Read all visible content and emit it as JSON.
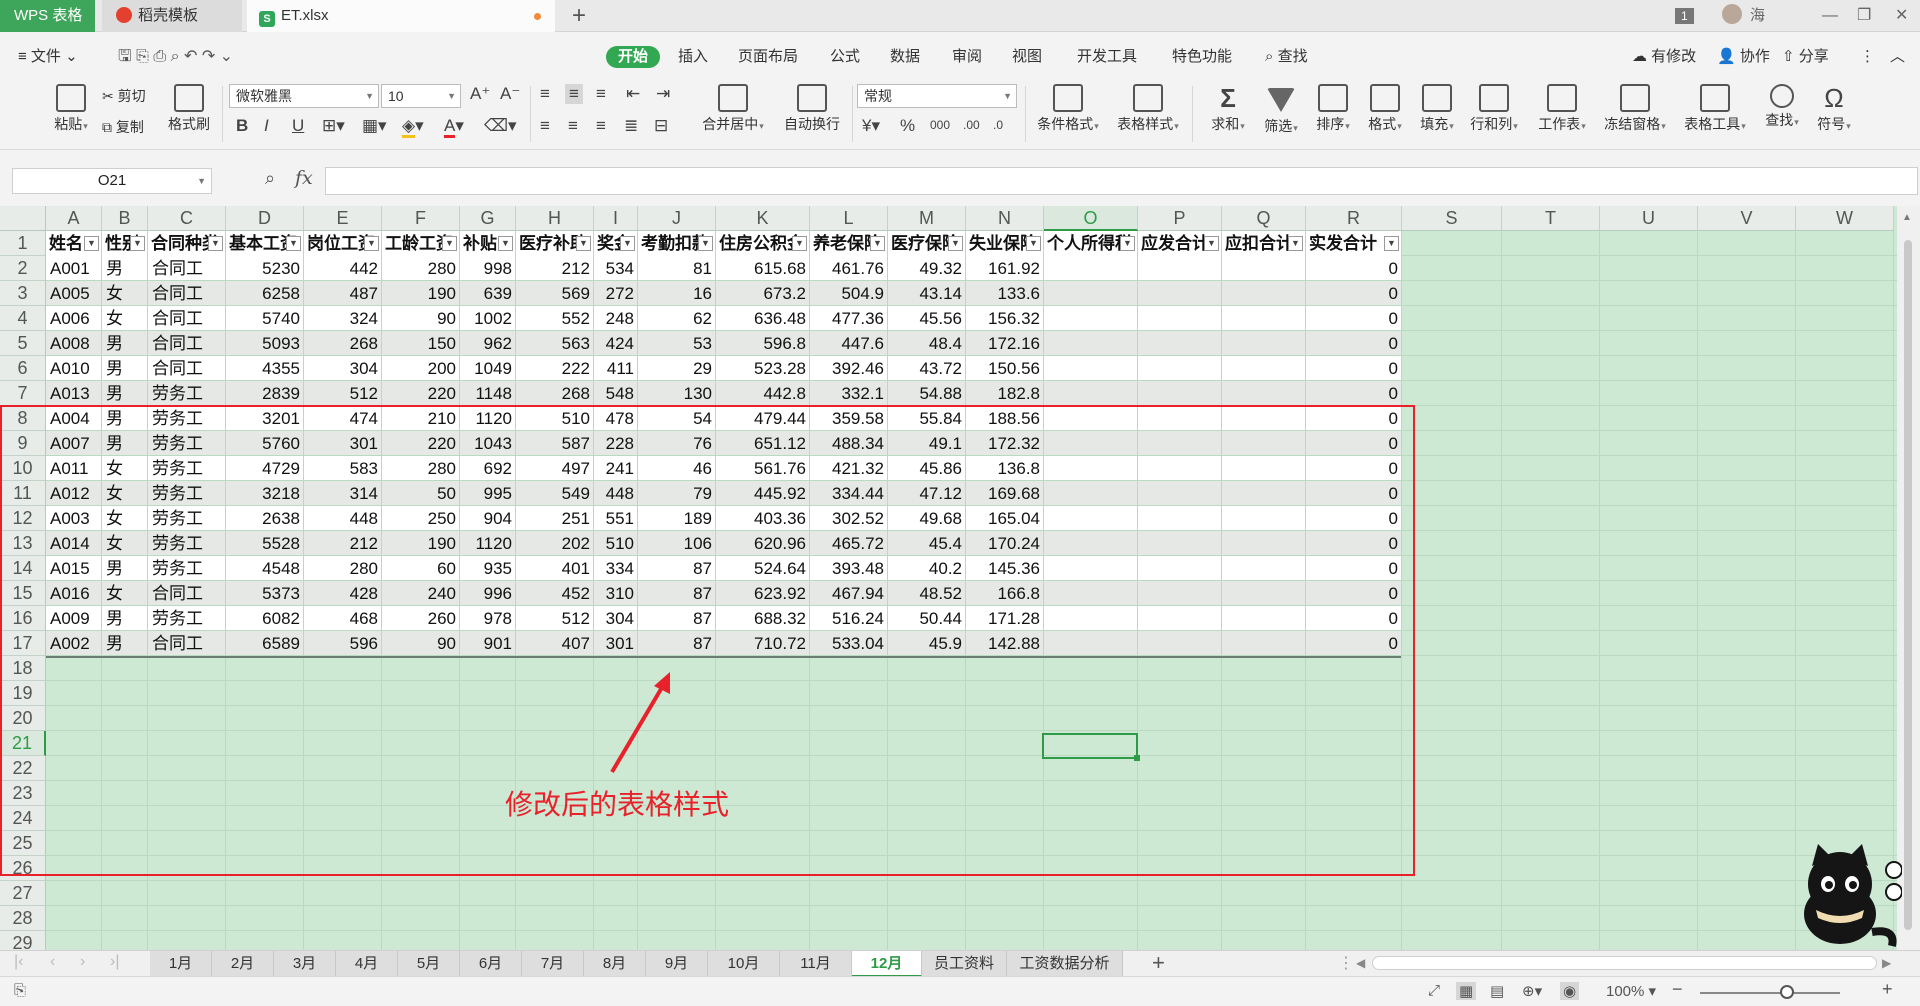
{
  "title_bar": {
    "app_tab": "WPS 表格",
    "tabs": [
      {
        "label": "稻壳模板",
        "icon": "daoke-icon"
      },
      {
        "label": "ET.xlsx",
        "icon": "spreadsheet-icon"
      }
    ],
    "badge": "1",
    "user": "海"
  },
  "menu": {
    "file": "文件",
    "items": [
      "开始",
      "插入",
      "页面布局",
      "公式",
      "数据",
      "审阅",
      "视图",
      "开发工具",
      "特色功能"
    ],
    "active": "开始",
    "search": "查找",
    "right": [
      "有修改",
      "协作",
      "分享"
    ]
  },
  "ribbon": {
    "paste": "粘贴",
    "cut": "剪切",
    "copy": "复制",
    "format_painter": "格式刷",
    "font_name": "微软雅黑",
    "font_size": "10",
    "merge": "合并居中",
    "wrap": "自动换行",
    "number_format": "常规",
    "cond_format": "条件格式",
    "table_style": "表格样式",
    "sum": "求和",
    "filter": "筛选",
    "sort": "排序",
    "format": "格式",
    "fill": "填充",
    "row_col": "行和列",
    "worksheet": "工作表",
    "freeze": "冻结窗格",
    "table_tools": "表格工具",
    "find": "查找",
    "symbol": "符号",
    "pct": "%",
    "thousands": "000"
  },
  "formula_bar": {
    "name_box": "O21",
    "fx": "fx",
    "value": ""
  },
  "columns": [
    "A",
    "B",
    "C",
    "D",
    "E",
    "F",
    "G",
    "H",
    "I",
    "J",
    "K",
    "L",
    "M",
    "N",
    "O",
    "P",
    "Q",
    "R",
    "S",
    "T",
    "U",
    "V",
    "W"
  ],
  "selected_column": "O",
  "rows": [
    "1",
    "2",
    "3",
    "4",
    "5",
    "6",
    "7",
    "8",
    "9",
    "10",
    "11",
    "12",
    "13",
    "14",
    "15",
    "16",
    "17",
    "18",
    "19",
    "20",
    "21",
    "22",
    "23",
    "24",
    "25",
    "26",
    "27",
    "28",
    "29"
  ],
  "selected_row": "21",
  "table": {
    "headers": [
      "姓名",
      "性别",
      "合同种类",
      "基本工资",
      "岗位工资",
      "工龄工资",
      "补贴",
      "医疗补助",
      "奖金",
      "考勤扣款",
      "住房公积金",
      "养老保险",
      "医疗保险",
      "失业保险",
      "个人所得税",
      "应发合计",
      "应扣合计",
      "实发合计"
    ],
    "header_display": [
      "姓名",
      "性别",
      "合同种类",
      "基本工资",
      "岗位工资",
      "工龄工资",
      "补贴",
      "医疗补助",
      "奖金",
      "考勤扣款",
      "住房公积金",
      "养老保险",
      "医疗保险",
      "失业保险",
      "个人所得税",
      "应发合计",
      "应扣合计",
      "实发合计"
    ],
    "data": [
      [
        "A001",
        "男",
        "合同工",
        "5230",
        "442",
        "280",
        "998",
        "212",
        "534",
        "81",
        "615.68",
        "461.76",
        "49.32",
        "161.92",
        "",
        "",
        "",
        "0"
      ],
      [
        "A005",
        "女",
        "合同工",
        "6258",
        "487",
        "190",
        "639",
        "569",
        "272",
        "16",
        "673.2",
        "504.9",
        "43.14",
        "133.6",
        "",
        "",
        "",
        "0"
      ],
      [
        "A006",
        "女",
        "合同工",
        "5740",
        "324",
        "90",
        "1002",
        "552",
        "248",
        "62",
        "636.48",
        "477.36",
        "45.56",
        "156.32",
        "",
        "",
        "",
        "0"
      ],
      [
        "A008",
        "男",
        "合同工",
        "5093",
        "268",
        "150",
        "962",
        "563",
        "424",
        "53",
        "596.8",
        "447.6",
        "48.4",
        "172.16",
        "",
        "",
        "",
        "0"
      ],
      [
        "A010",
        "男",
        "合同工",
        "4355",
        "304",
        "200",
        "1049",
        "222",
        "411",
        "29",
        "523.28",
        "392.46",
        "43.72",
        "150.56",
        "",
        "",
        "",
        "0"
      ],
      [
        "A013",
        "男",
        "劳务工",
        "2839",
        "512",
        "220",
        "1148",
        "268",
        "548",
        "130",
        "442.8",
        "332.1",
        "54.88",
        "182.8",
        "",
        "",
        "",
        "0"
      ],
      [
        "A004",
        "男",
        "劳务工",
        "3201",
        "474",
        "210",
        "1120",
        "510",
        "478",
        "54",
        "479.44",
        "359.58",
        "55.84",
        "188.56",
        "",
        "",
        "",
        "0"
      ],
      [
        "A007",
        "男",
        "劳务工",
        "5760",
        "301",
        "220",
        "1043",
        "587",
        "228",
        "76",
        "651.12",
        "488.34",
        "49.1",
        "172.32",
        "",
        "",
        "",
        "0"
      ],
      [
        "A011",
        "女",
        "劳务工",
        "4729",
        "583",
        "280",
        "692",
        "497",
        "241",
        "46",
        "561.76",
        "421.32",
        "45.86",
        "136.8",
        "",
        "",
        "",
        "0"
      ],
      [
        "A012",
        "女",
        "劳务工",
        "3218",
        "314",
        "50",
        "995",
        "549",
        "448",
        "79",
        "445.92",
        "334.44",
        "47.12",
        "169.68",
        "",
        "",
        "",
        "0"
      ],
      [
        "A003",
        "女",
        "劳务工",
        "2638",
        "448",
        "250",
        "904",
        "251",
        "551",
        "189",
        "403.36",
        "302.52",
        "49.68",
        "165.04",
        "",
        "",
        "",
        "0"
      ],
      [
        "A014",
        "女",
        "劳务工",
        "5528",
        "212",
        "190",
        "1120",
        "202",
        "510",
        "106",
        "620.96",
        "465.72",
        "45.4",
        "170.24",
        "",
        "",
        "",
        "0"
      ],
      [
        "A015",
        "男",
        "劳务工",
        "4548",
        "280",
        "60",
        "935",
        "401",
        "334",
        "87",
        "524.64",
        "393.48",
        "40.2",
        "145.36",
        "",
        "",
        "",
        "0"
      ],
      [
        "A016",
        "女",
        "合同工",
        "5373",
        "428",
        "240",
        "996",
        "452",
        "310",
        "87",
        "623.92",
        "467.94",
        "48.52",
        "166.8",
        "",
        "",
        "",
        "0"
      ],
      [
        "A009",
        "男",
        "劳务工",
        "6082",
        "468",
        "260",
        "978",
        "512",
        "304",
        "87",
        "688.32",
        "516.24",
        "50.44",
        "171.28",
        "",
        "",
        "",
        "0"
      ],
      [
        "A002",
        "男",
        "合同工",
        "6589",
        "596",
        "90",
        "901",
        "407",
        "301",
        "87",
        "710.72",
        "533.04",
        "45.9",
        "142.88",
        "",
        "",
        "",
        "0"
      ]
    ]
  },
  "annotation": "修改后的表格样式",
  "sheet_tabs": [
    "1月",
    "2月",
    "3月",
    "4月",
    "5月",
    "6月",
    "7月",
    "8月",
    "9月",
    "10月",
    "11月",
    "12月",
    "员工资料",
    "工资数据分析"
  ],
  "active_sheet": "12月",
  "status": {
    "zoom": "100%"
  },
  "colors": {
    "accent": "#2e9b47",
    "sheet_bg": "#cde9d3",
    "annotation": "#e8212b"
  }
}
